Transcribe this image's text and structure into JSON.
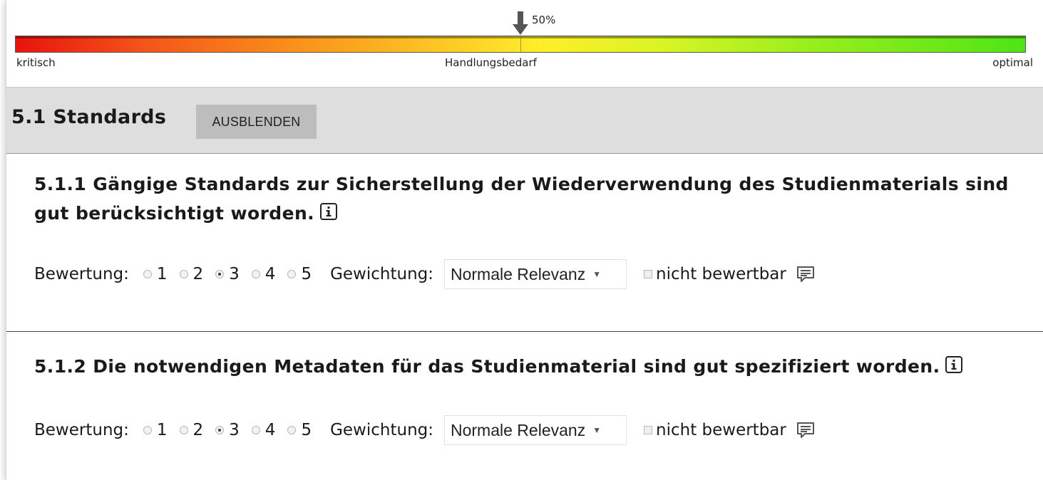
{
  "scale": {
    "percent_label": "50%",
    "value_fraction": 0.5,
    "left_label": "kritisch",
    "middle_label": "Handlungsbedarf",
    "right_label": "optimal",
    "colors": [
      "#e8130d",
      "#f9921c",
      "#ffee2a",
      "#9bef1c",
      "#4fe416"
    ]
  },
  "section": {
    "title": "5.1 Standards",
    "toggle_button_label": "AUSBLENDEN"
  },
  "criteria": [
    {
      "title": "5.1.1 Gängige Standards zur Sicherstellung der Wiederverwendung des Studienmaterials sind gut berücksichtigt worden.",
      "rating_label": "Bewertung:",
      "rating_options": [
        "1",
        "2",
        "3",
        "4",
        "5"
      ],
      "selected_rating": "3",
      "weight_label": "Gewichtung:",
      "weight_value": "Normale Relevanz",
      "not_ratable_label": "nicht bewertbar",
      "not_ratable_checked": false
    },
    {
      "title": "5.1.2 Die notwendigen Metadaten für das Studienmaterial sind gut spezifiziert worden.",
      "rating_label": "Bewertung:",
      "rating_options": [
        "1",
        "2",
        "3",
        "4",
        "5"
      ],
      "selected_rating": "3",
      "weight_label": "Gewichtung:",
      "weight_value": "Normale Relevanz",
      "not_ratable_label": "nicht bewertbar",
      "not_ratable_checked": false
    }
  ],
  "icons": {
    "info": "info-icon",
    "comment": "comment-icon",
    "marker": "arrow-down-icon"
  }
}
